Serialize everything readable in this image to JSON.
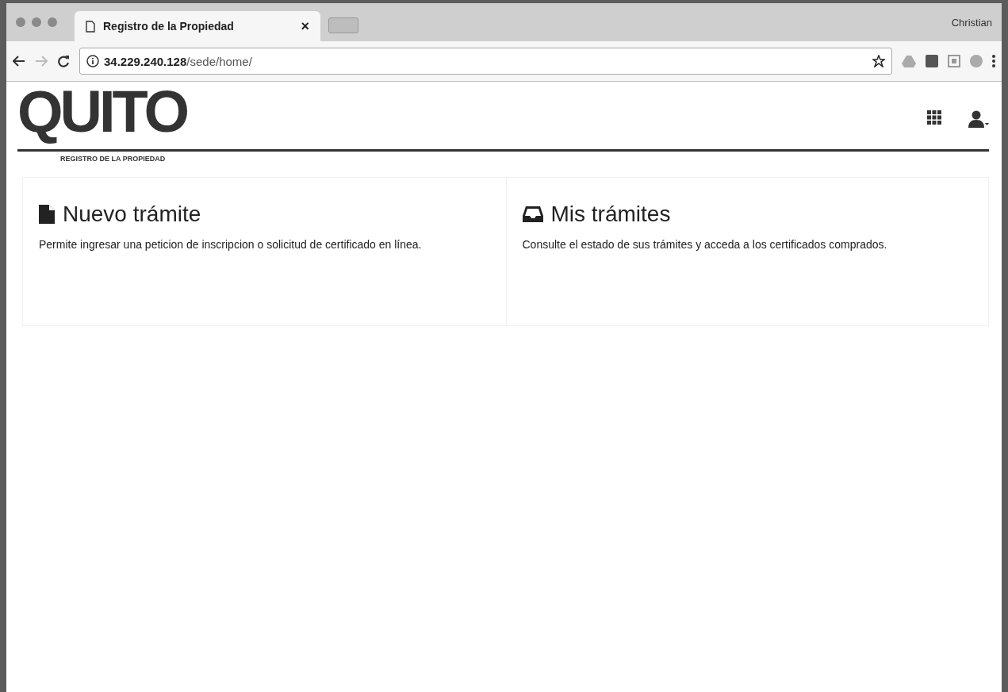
{
  "browser": {
    "tab": {
      "title": "Registro de la Propiedad",
      "close": "×"
    },
    "profile": "Christian",
    "address": {
      "host": "34.229.240.128",
      "path": "/sede/home/"
    }
  },
  "header": {
    "logo": "QUITO",
    "logo_subtitle": "REGISTRO DE LA PROPIEDAD"
  },
  "cards": [
    {
      "kind": "file",
      "title": "Nuevo trámite",
      "text": "Permite ingresar una peticion de inscripcion o solicitud de certificado en línea."
    },
    {
      "kind": "inbox",
      "title": "Mis trámites",
      "text": "Consulte el estado de sus trámites y acceda a los certificados comprados."
    }
  ]
}
